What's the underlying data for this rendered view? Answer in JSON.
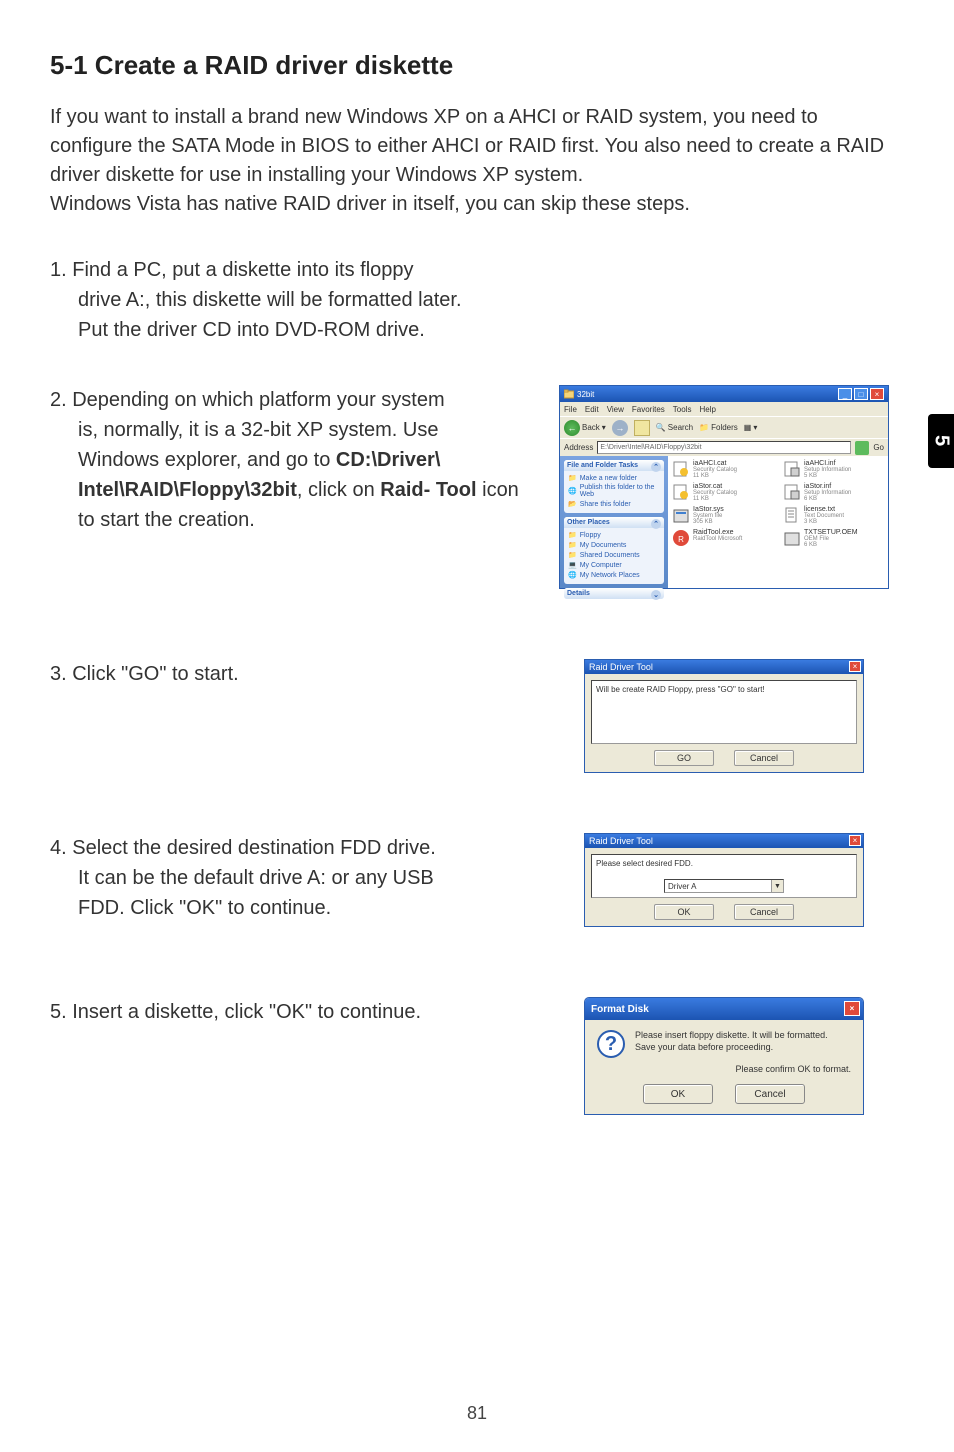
{
  "heading": "5-1 Create a RAID driver diskette",
  "intro": "If you want to install a brand new Windows XP on a AHCI or RAID system, you need to configure the SATA Mode in BIOS to either AHCI or RAID first. You also need to create a RAID driver diskette for use in installing your Windows XP system.\nWindows Vista has native RAID driver in itself, you can skip these steps.",
  "side_tab": "5",
  "page_number": "81",
  "steps": {
    "s1_lead": "1. Find a PC, put a diskette into its floppy ",
    "s1_line2": "drive A:, this diskette will be formatted later. ",
    "s1_line3": "Put the driver CD into DVD-ROM drive.",
    "s2_lead": "2. Depending on which platform your system ",
    "s2_line2_a": "is, normally, it is a 32-bit XP system. Use ",
    "s2_line2_b": "Windows explorer, and go to ",
    "s2_bold1": "CD:\\Driver\\",
    "s2_bold2": "Intel\\RAID\\Floppy\\32bit",
    "s2_line2_c": ", click on ",
    "s2_bold3": "Raid-",
    "s2_bold4": "Tool",
    "s2_line2_d": " icon to start the creation.",
    "s3": "3. Click \"GO\" to start.",
    "s4_lead": "4. Select the desired destination FDD drive. ",
    "s4_line2": "It can be the default drive A: or any USB ",
    "s4_line3": "FDD. Click \"OK\" to continue.",
    "s5": "5. Insert a diskette, click \"OK\" to continue."
  },
  "explorer": {
    "title": "32bit",
    "menus": [
      "File",
      "Edit",
      "View",
      "Favorites",
      "Tools",
      "Help"
    ],
    "toolbar": {
      "back": "Back",
      "search": "Search",
      "folders": "Folders"
    },
    "address_label": "Address",
    "address_value": "E:\\Driver\\Intel\\RAID\\Floppy\\32bit",
    "go": "Go",
    "sidebar": {
      "panel1_title": "File and Folder Tasks",
      "panel1_items": [
        "Make a new folder",
        "Publish this folder to the Web",
        "Share this folder"
      ],
      "panel2_title": "Other Places",
      "panel2_items": [
        "Floppy",
        "My Documents",
        "Shared Documents",
        "My Computer",
        "My Network Places"
      ],
      "panel3_title": "Details"
    },
    "files": [
      {
        "name": "iaAHCI.cat",
        "type": "Security Catalog",
        "size": "11 KB"
      },
      {
        "name": "iaAHCI.inf",
        "type": "Setup Information",
        "size": "5 KB"
      },
      {
        "name": "iaStor.cat",
        "type": "Security Catalog",
        "size": "11 KB"
      },
      {
        "name": "iaStor.inf",
        "type": "Setup Information",
        "size": "6 KB"
      },
      {
        "name": "IaStor.sys",
        "type": "System file",
        "size": "305 KB"
      },
      {
        "name": "license.txt",
        "type": "Text Document",
        "size": "3 KB"
      },
      {
        "name": "RaidTool.exe",
        "type": "RaidTool Microsoft ",
        "size": ""
      },
      {
        "name": "TXTSETUP.OEM",
        "type": "OEM File",
        "size": "6 KB"
      }
    ]
  },
  "raidtool_go": {
    "title": "Raid Driver Tool",
    "message": "Will be create RAID Floppy, press \"GO\" to start!",
    "btn_go": "GO",
    "btn_cancel": "Cancel"
  },
  "raidtool_fdd": {
    "title": "Raid Driver Tool",
    "message": "Please select desired FDD.",
    "combo_value": "Driver A",
    "btn_ok": "OK",
    "btn_cancel": "Cancel"
  },
  "format_disk": {
    "title": "Format Disk",
    "message": "Please insert floppy diskette.  It will be formatted.\nSave your data before proceeding.",
    "confirm": "Please confirm OK to format.",
    "btn_ok": "OK",
    "btn_cancel": "Cancel"
  }
}
